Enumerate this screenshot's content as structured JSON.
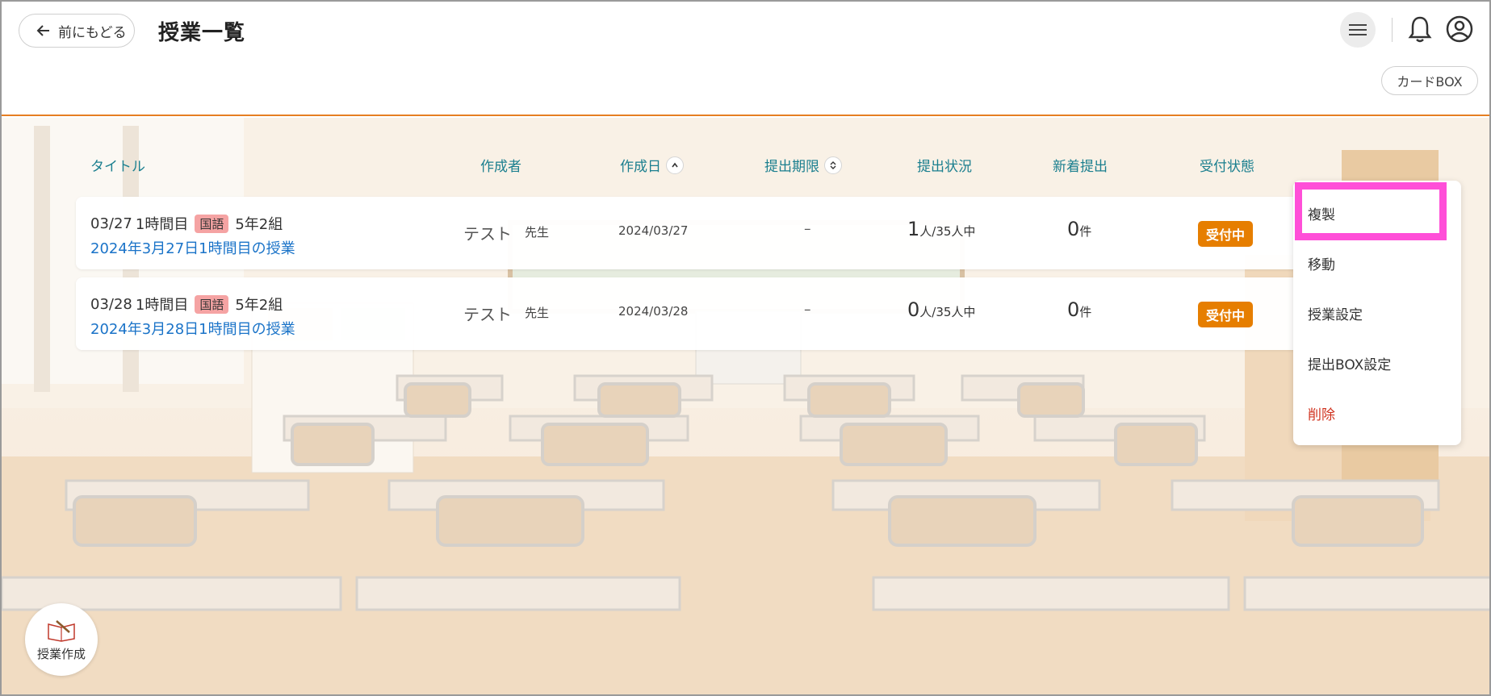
{
  "header": {
    "back_label": "前にもどる",
    "title": "授業一覧",
    "cardbox_label": "カードBOX"
  },
  "table": {
    "columns": {
      "title": "タイトル",
      "author": "作成者",
      "created": "作成日",
      "deadline": "提出期限",
      "submission": "提出状況",
      "new_submission": "新着提出",
      "status": "受付状態"
    },
    "rows": [
      {
        "date_short": "03/27",
        "period": "1時間目",
        "subject": "国語",
        "class": "5年2組",
        "lesson_title": "2024年3月27日1時間目の授業",
        "author": "テスト",
        "author_suffix": "先生",
        "created": "2024/03/27",
        "deadline": "–",
        "submitted_count": "1",
        "submitted_suffix": "人/35人中",
        "new_count": "0",
        "new_suffix": "件",
        "status": "受付中"
      },
      {
        "date_short": "03/28",
        "period": "1時間目",
        "subject": "国語",
        "class": "5年2組",
        "lesson_title": "2024年3月28日1時間目の授業",
        "author": "テスト",
        "author_suffix": "先生",
        "created": "2024/03/28",
        "deadline": "–",
        "submitted_count": "0",
        "submitted_suffix": "人/35人中",
        "new_count": "0",
        "new_suffix": "件",
        "status": "受付中"
      }
    ]
  },
  "context_menu": {
    "items": [
      "複製",
      "移動",
      "授業設定",
      "提出BOX設定",
      "削除"
    ]
  },
  "fab": {
    "label": "授業作成"
  },
  "icons": {
    "back": "arrow-left-icon",
    "menu": "hamburger-icon",
    "bell": "bell-icon",
    "user": "user-circle-icon",
    "sort": "chevron-icon",
    "fab": "notebook-pencil-icon"
  },
  "colors": {
    "accent_orange": "#e67e22",
    "heading_teal": "#1b7f8f",
    "link_blue": "#1a73c8",
    "status_orange": "#e67e00",
    "subject_badge": "#f5a3a3",
    "highlight_magenta": "#ff4fd8",
    "delete_red": "#d0331f"
  }
}
